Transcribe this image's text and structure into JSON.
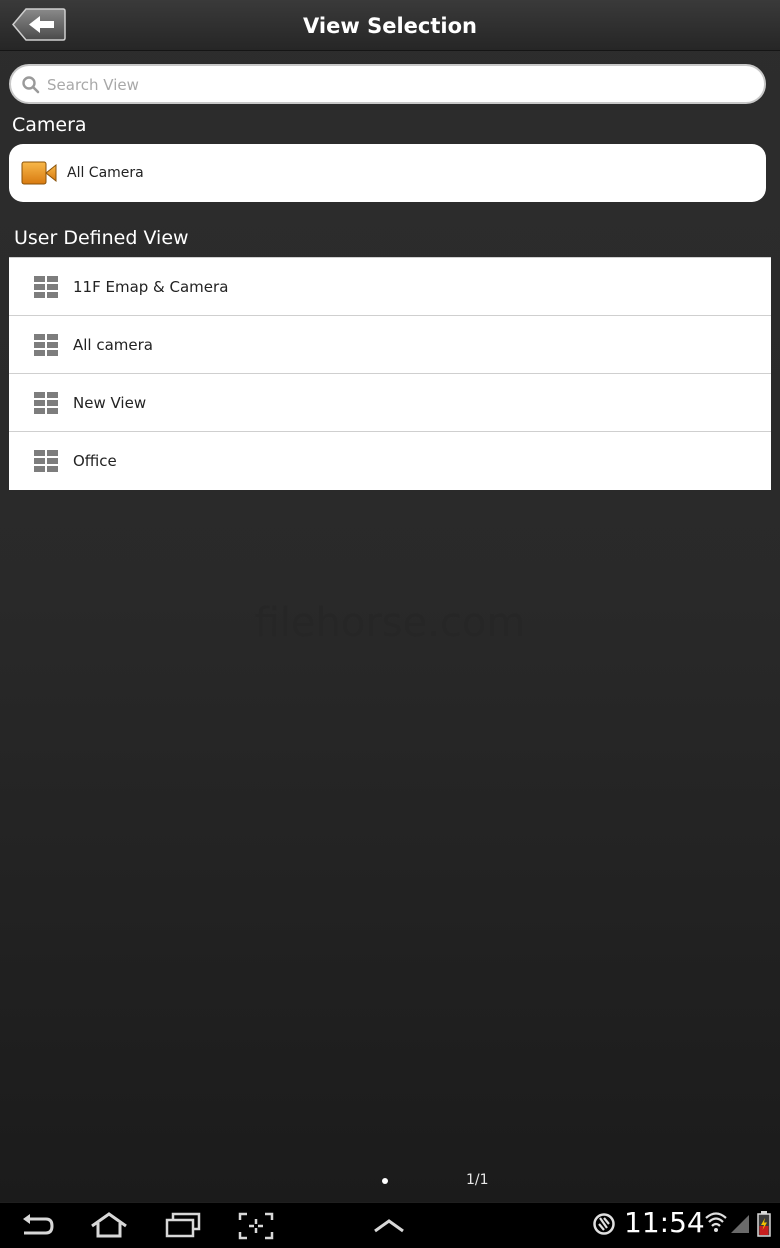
{
  "header": {
    "title": "View Selection"
  },
  "search": {
    "placeholder": "Search View",
    "value": ""
  },
  "camera_section": {
    "title": "Camera",
    "item_label": "All Camera"
  },
  "user_views_section": {
    "title": "User Defined View",
    "items": [
      {
        "label": "11F Emap & Camera"
      },
      {
        "label": "All camera"
      },
      {
        "label": "New View"
      },
      {
        "label": "Office"
      }
    ]
  },
  "watermark": "filehorse.com",
  "pager": {
    "indicator": "1/1"
  },
  "status_bar": {
    "time": "11:54"
  },
  "colors": {
    "accent_camera": "#e8921a"
  },
  "icons": {
    "back": "back-arrow-icon",
    "search": "search-icon",
    "camera": "video-camera-icon",
    "view": "grid-view-icon",
    "nav_back": "nav-back-icon",
    "nav_home": "home-icon",
    "nav_recent": "recent-apps-icon",
    "nav_screenshot": "screenshot-icon",
    "nav_up": "chevron-up-icon",
    "status_sync": "sync-icon",
    "status_wifi": "wifi-icon",
    "status_signal": "signal-icon",
    "status_battery": "battery-icon"
  }
}
